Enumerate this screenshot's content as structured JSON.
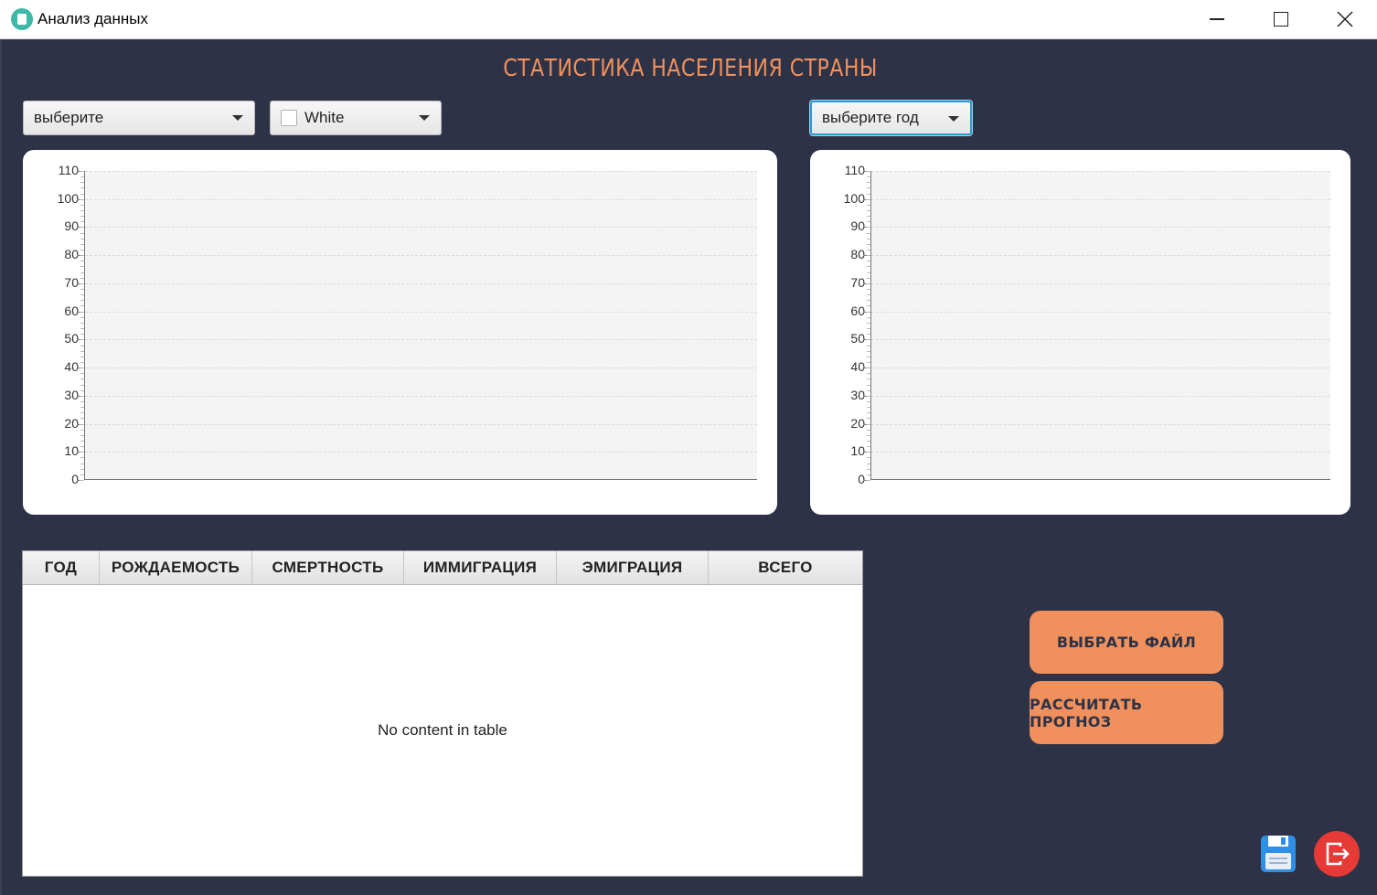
{
  "window": {
    "title": "Анализ данных"
  },
  "heading": "СТАТИСТИКА НАСЕЛЕНИЯ СТРАНЫ",
  "controls": {
    "select_left": "выберите",
    "select_color": "White",
    "select_year": "выберите год"
  },
  "chart_data": [
    {
      "type": "line",
      "ylim": [
        0,
        110
      ],
      "yticks": [
        "110",
        "100",
        "90",
        "80",
        "70",
        "60",
        "50",
        "40",
        "30",
        "20",
        "10",
        "0"
      ],
      "grid": true,
      "series": []
    },
    {
      "type": "bar",
      "ylim": [
        0,
        110
      ],
      "yticks": [
        "110",
        "100",
        "90",
        "80",
        "70",
        "60",
        "50",
        "40",
        "30",
        "20",
        "10",
        "0"
      ],
      "grid": true,
      "series": []
    }
  ],
  "table": {
    "columns": [
      "ГОД",
      "РОЖДАЕМОСТЬ",
      "СМЕРТНОСТЬ",
      "ИММИГРАЦИЯ",
      "ЭМИГРАЦИЯ",
      "ВСЕГО"
    ],
    "rows": [],
    "empty_message": "No content in table"
  },
  "buttons": {
    "choose_file": "ВЫБРАТЬ ФАЙЛ",
    "forecast": "РАССЧИТАТЬ ПРОГНОЗ"
  },
  "icons": {
    "save": "save-icon",
    "exit": "exit-icon"
  },
  "colors": {
    "background": "#2d3247",
    "accent": "#f0905c",
    "exit": "#e53a35",
    "save": "#2f8fe6"
  }
}
